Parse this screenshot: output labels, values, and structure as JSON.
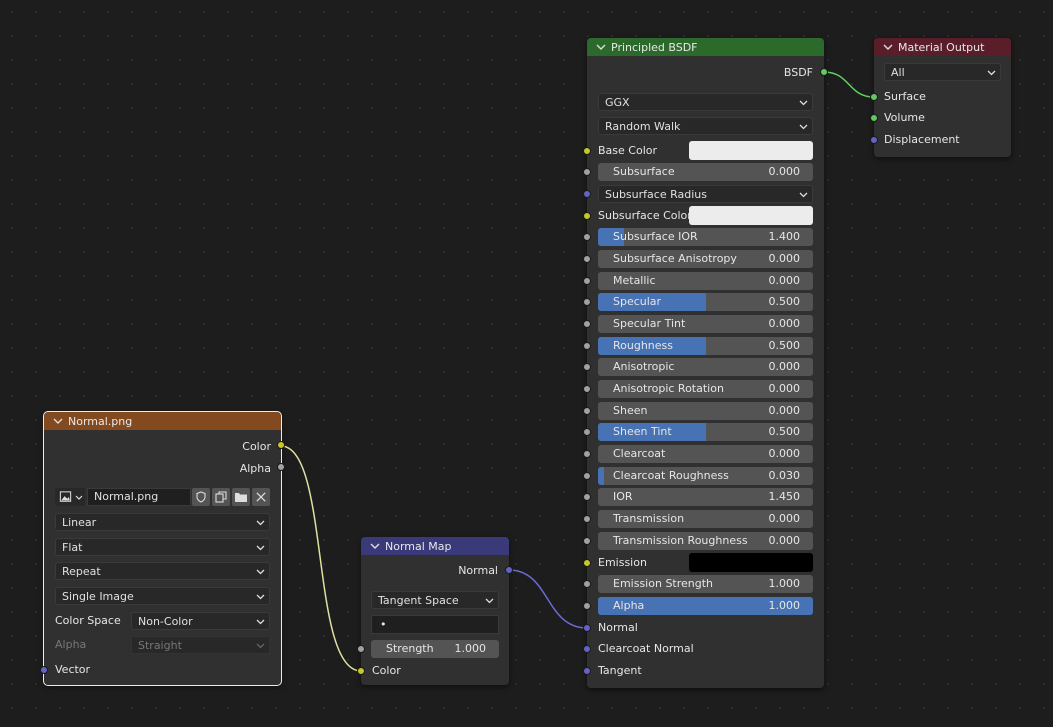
{
  "image_node": {
    "title": "Normal.png",
    "outputs": {
      "color": "Color",
      "alpha": "Alpha"
    },
    "image_name": "Normal.png",
    "interpolation": "Linear",
    "projection": "Flat",
    "extension": "Repeat",
    "source": "Single Image",
    "color_space_label": "Color Space",
    "color_space": "Non-Color",
    "alpha_label": "Alpha",
    "alpha_mode": "Straight",
    "input_vector": "Vector"
  },
  "normal_map_node": {
    "title": "Normal Map",
    "output_normal": "Normal",
    "space": "Tangent Space",
    "uv_map": "•",
    "strength_label": "Strength",
    "strength_value": "1.000",
    "input_color": "Color"
  },
  "bsdf_node": {
    "title": "Principled BSDF",
    "output": "BSDF",
    "distribution": "GGX",
    "subsurface_method": "Random Walk",
    "base_color_label": "Base Color",
    "subsurface_radius_label": "Subsurface Radius",
    "subsurface_color_label": "Subsurface Color",
    "emission_label": "Emission",
    "fields": [
      {
        "label": "Subsurface",
        "value": "0.000",
        "fill": 0
      },
      {
        "label": "Subsurface IOR",
        "value": "1.400",
        "fill": 0.12
      },
      {
        "label": "Subsurface Anisotropy",
        "value": "0.000",
        "fill": 0
      },
      {
        "label": "Metallic",
        "value": "0.000",
        "fill": 0
      },
      {
        "label": "Specular",
        "value": "0.500",
        "fill": 0.5
      },
      {
        "label": "Specular Tint",
        "value": "0.000",
        "fill": 0
      },
      {
        "label": "Roughness",
        "value": "0.500",
        "fill": 0.5
      },
      {
        "label": "Anisotropic",
        "value": "0.000",
        "fill": 0
      },
      {
        "label": "Anisotropic Rotation",
        "value": "0.000",
        "fill": 0
      },
      {
        "label": "Sheen",
        "value": "0.000",
        "fill": 0
      },
      {
        "label": "Sheen Tint",
        "value": "0.500",
        "fill": 0.5
      },
      {
        "label": "Clearcoat",
        "value": "0.000",
        "fill": 0
      },
      {
        "label": "Clearcoat Roughness",
        "value": "0.030",
        "fill": 0.03
      },
      {
        "label": "IOR",
        "value": "1.450",
        "fill": 0
      },
      {
        "label": "Transmission",
        "value": "0.000",
        "fill": 0
      },
      {
        "label": "Transmission Roughness",
        "value": "0.000",
        "fill": 0
      },
      {
        "label": "Emission Strength",
        "value": "1.000",
        "fill": 0
      },
      {
        "label": "Alpha",
        "value": "1.000",
        "fill": 1
      }
    ],
    "input_normal": "Normal",
    "input_clearcoat_normal": "Clearcoat Normal",
    "input_tangent": "Tangent"
  },
  "output_node": {
    "title": "Material Output",
    "target": "All",
    "inputs": {
      "surface": "Surface",
      "volume": "Volume",
      "displacement": "Displacement"
    }
  },
  "colors": {
    "image_header": "#83491f",
    "normal_map_header": "#3a3a7a",
    "bsdf_header": "#2c6a2c",
    "output_header": "#5a1e2a",
    "field_fill": "#4772b3",
    "wire_color": "#e0e0a0",
    "wire_vector": "#6b6bd0",
    "wire_shader": "#5fd05f"
  }
}
